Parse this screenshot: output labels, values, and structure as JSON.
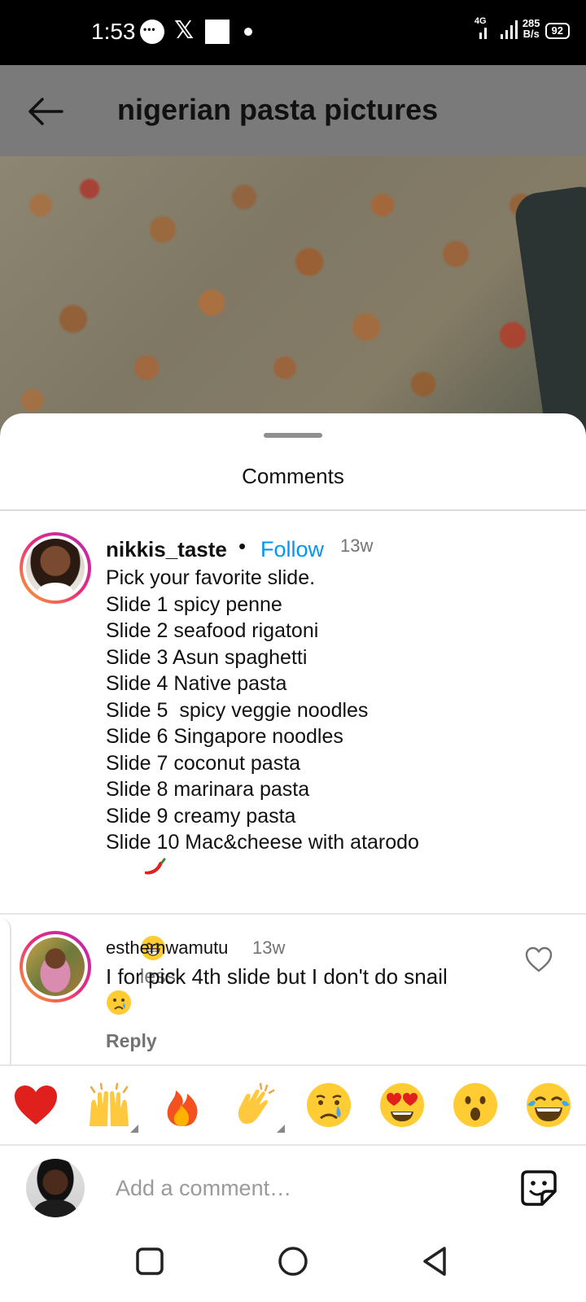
{
  "status_bar": {
    "time": "1:53",
    "network_gen": "4G",
    "net_speed_value": "285",
    "net_speed_unit": "B/s",
    "battery": "92"
  },
  "header": {
    "title": "nigerian pasta pictures",
    "back_icon": "arrow-left-icon"
  },
  "sheet": {
    "title": "Comments"
  },
  "comments": [
    {
      "username": "nikkis_taste",
      "separator": "•",
      "follow_label": "Follow",
      "time": "13w",
      "lines": [
        "Pick your favorite slide.",
        "Slide 1 spicy penne",
        "Slide 2 seafood rigatoni",
        "Slide 3 Asun spaghetti",
        "Slide 4 Native pasta",
        "Slide 5  spicy veggie noodles",
        "Slide 6 Singapore noodles",
        "Slide 7 coconut pasta",
        "Slide 8 marinara pasta",
        "Slide 9 creamy pasta",
        "Slide 10 Mac&cheese with atarodo"
      ],
      "less_label": "less"
    },
    {
      "username": "esthernwamutu",
      "time": "13w",
      "text": "I for pick 4th slide but I don't do snail",
      "reply_label": "Reply"
    }
  ],
  "emoji_bar": [
    "red-heart",
    "raising-hands",
    "fire",
    "clapping-hands",
    "crying-face",
    "heart-eyes",
    "astonished-face",
    "tears-of-joy"
  ],
  "comment_input": {
    "placeholder": "Add a comment…"
  },
  "colors": {
    "follow": "#0095f6",
    "secondary_text": "#737373",
    "header_bg": "#7a7a7a"
  }
}
